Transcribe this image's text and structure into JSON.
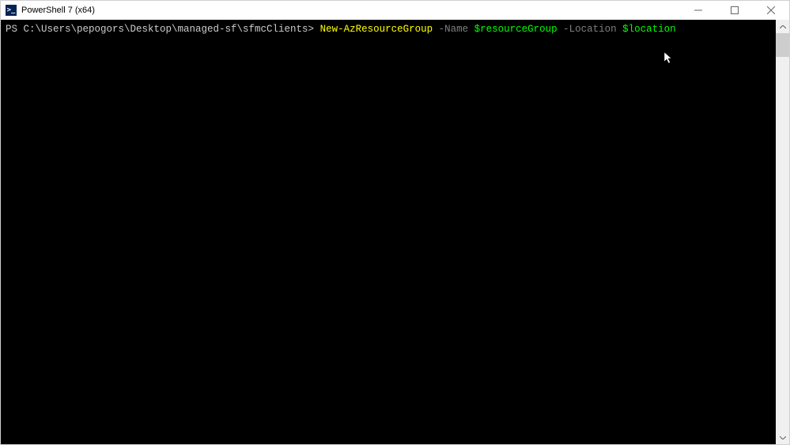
{
  "titlebar": {
    "icon_text": ">_",
    "title": "PowerShell 7 (x64)"
  },
  "terminal": {
    "prompt": "PS C:\\Users\\pepogors\\Desktop\\managed-sf\\sfmcClients> ",
    "command": {
      "cmdlet": "New-AzResourceGroup",
      "param1": " -Name ",
      "var1": "$resourceGroup",
      "param2": " -Location ",
      "var2": "$location"
    }
  }
}
